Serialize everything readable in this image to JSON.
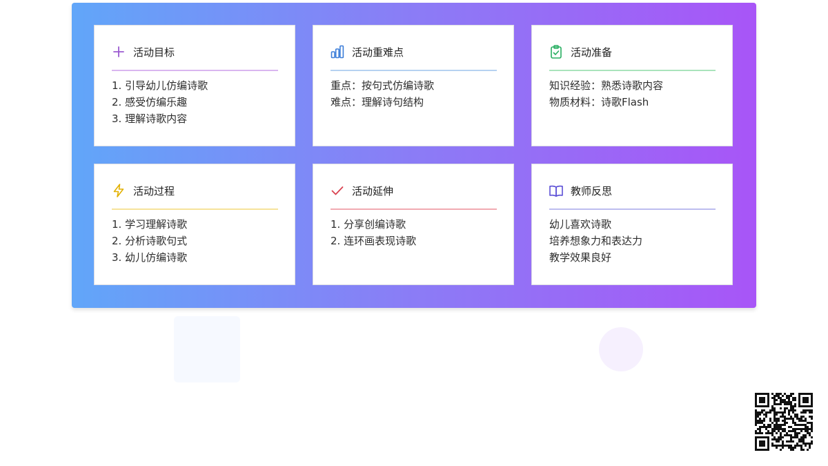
{
  "cards": [
    {
      "title": "活动目标",
      "icon": "plus-icon",
      "accent": "#c7a1ea",
      "lines": [
        "1. 引导幼儿仿编诗歌",
        "2. 感受仿编乐趣",
        "3. 理解诗歌内容"
      ]
    },
    {
      "title": "活动重难点",
      "icon": "bar-chart-icon",
      "accent": "#a8c8ef",
      "lines": [
        "重点：按句式仿编诗歌",
        "难点：理解诗句结构"
      ]
    },
    {
      "title": "活动准备",
      "icon": "clipboard-check-icon",
      "accent": "#9ddcb1",
      "lines": [
        "知识经验：熟悉诗歌内容",
        "物质材料：诗歌Flash"
      ]
    },
    {
      "title": "活动过程",
      "icon": "lightning-icon",
      "accent": "#f3dc8c",
      "lines": [
        "1. 学习理解诗歌",
        "2. 分析诗歌句式",
        "3. 幼儿仿编诗歌"
      ]
    },
    {
      "title": "活动延伸",
      "icon": "checkmark-icon",
      "accent": "#ef9ea7",
      "lines": [
        "1. 分享创编诗歌",
        "2. 连环画表现诗歌"
      ]
    },
    {
      "title": "教师反思",
      "icon": "book-icon",
      "accent": "#b2b2ec",
      "lines": [
        "幼儿喜欢诗歌",
        "培养想象力和表达力",
        "教学效果良好"
      ]
    }
  ]
}
